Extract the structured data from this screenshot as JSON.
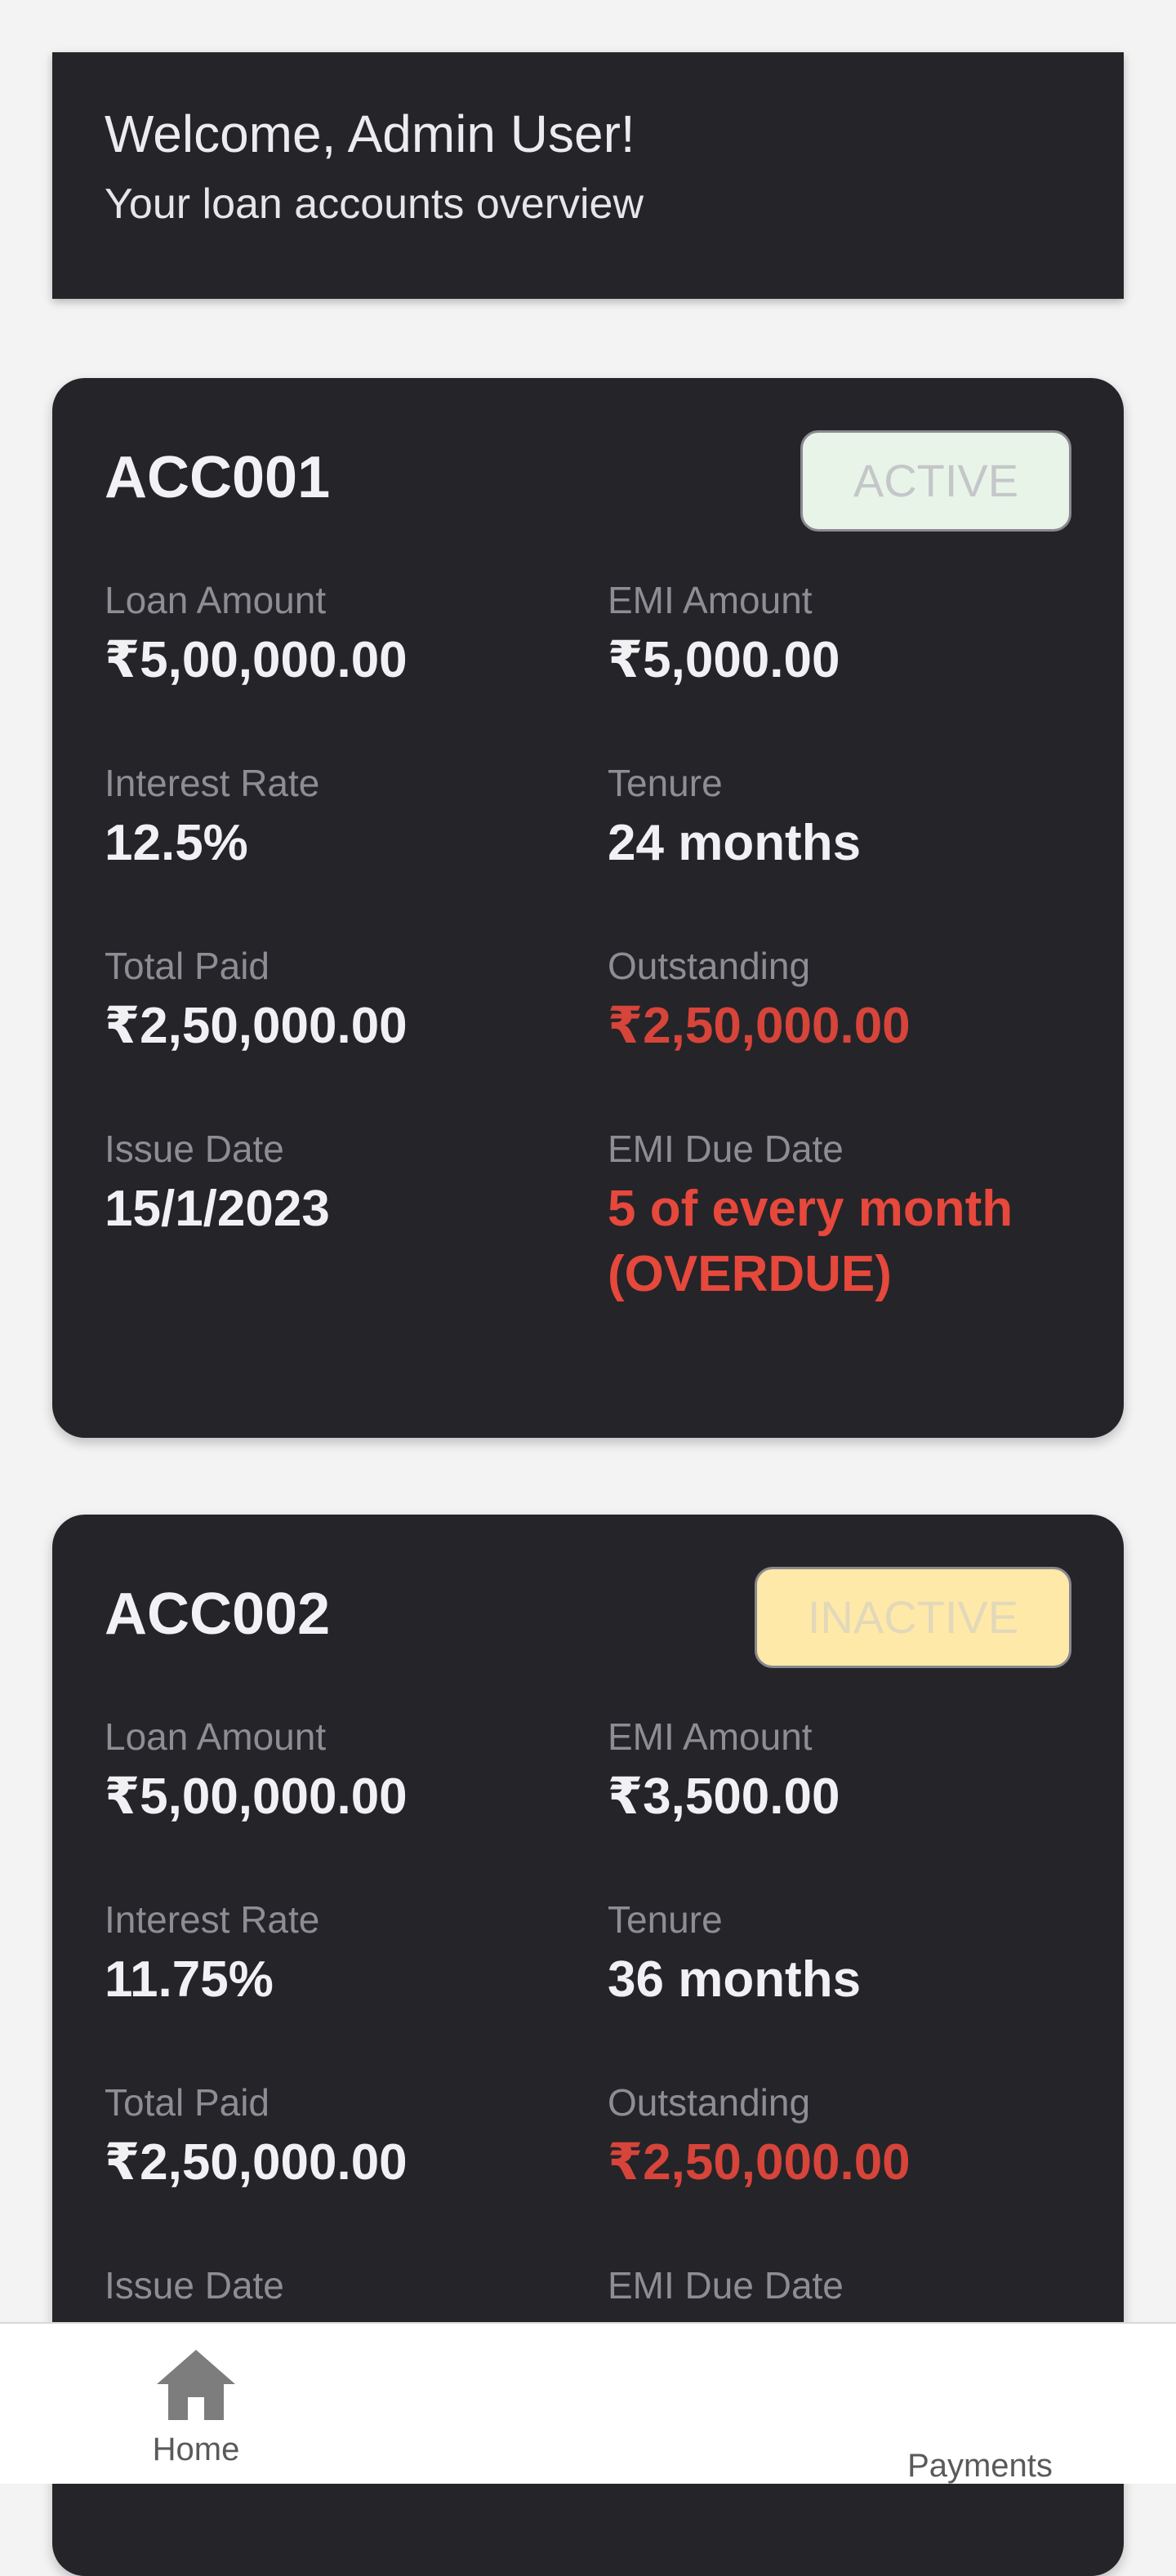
{
  "welcome": {
    "title": "Welcome, Admin User!",
    "subtitle": "Your loan accounts overview"
  },
  "accounts": [
    {
      "id": "ACC001",
      "status": "ACTIVE",
      "loan_amount_label": "Loan Amount",
      "loan_amount": "₹5,00,000.00",
      "emi_amount_label": "EMI Amount",
      "emi_amount": "₹5,000.00",
      "interest_rate_label": "Interest Rate",
      "interest_rate": "12.5%",
      "tenure_label": "Tenure",
      "tenure": "24 months",
      "total_paid_label": "Total Paid",
      "total_paid": "₹2,50,000.00",
      "outstanding_label": "Outstanding",
      "outstanding": "₹2,50,000.00",
      "issue_date_label": "Issue Date",
      "issue_date": "15/1/2023",
      "emi_due_label": "EMI Due Date",
      "emi_due_line1": "5 of every month",
      "emi_due_line2": "(OVERDUE)"
    },
    {
      "id": "ACC002",
      "status": "INACTIVE",
      "loan_amount_label": "Loan Amount",
      "loan_amount": "₹5,00,000.00",
      "emi_amount_label": "EMI Amount",
      "emi_amount": "₹3,500.00",
      "interest_rate_label": "Interest Rate",
      "interest_rate": "11.75%",
      "tenure_label": "Tenure",
      "tenure": "36 months",
      "total_paid_label": "Total Paid",
      "total_paid": "₹2,50,000.00",
      "outstanding_label": "Outstanding",
      "outstanding": "₹2,50,000.00",
      "issue_date_label": "Issue Date",
      "emi_due_label": "EMI Due Date"
    }
  ],
  "nav": {
    "home_label": "Home",
    "home_icon": "home-icon",
    "payments_label": "Payments"
  },
  "colors": {
    "card_bg": "#252429",
    "overdue_red": "#d7443a",
    "active_badge_bg": "#e9f4e8",
    "inactive_badge_bg": "#ffe9a8"
  }
}
